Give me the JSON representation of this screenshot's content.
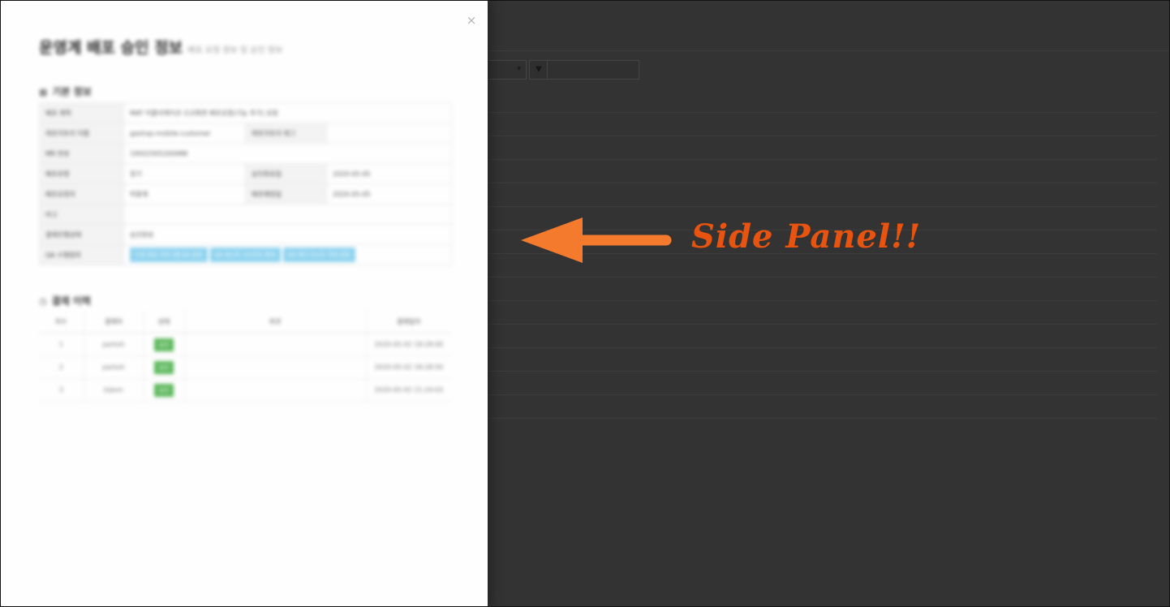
{
  "panel": {
    "close_symbol": "×",
    "title": "운영계 배포 승인 정보",
    "subtitle": "배포 요청 정보 및 승인 정보"
  },
  "basic_info": {
    "section_icon": "clipboard-icon",
    "title": "기본 정보",
    "rows": [
      [
        {
          "label": "배포 제목",
          "value": "MAT 어플리케이션 신규화면 배포요청(기능 추가) 요청",
          "span": 3
        }
      ],
      [
        {
          "label": "레포지토리 이름",
          "value": "gashop-mobile-customer"
        },
        {
          "label": "레포지토리 태그",
          "value": ""
        }
      ],
      [
        {
          "label": "MR 번호",
          "value": "19502505200988",
          "span": 3
        }
      ],
      [
        {
          "label": "배포유형",
          "value": "정기"
        },
        {
          "label": "승인완료일",
          "value": "2020-05-05"
        }
      ],
      [
        {
          "label": "배포요청자",
          "value": "박중재"
        },
        {
          "label": "배포예정일",
          "value": "2020-05-05"
        }
      ],
      [
        {
          "label": "비고",
          "value": "",
          "span": 3
        }
      ],
      [
        {
          "label": "결재진행상태",
          "value": "승인완료",
          "span": 3
        }
      ]
    ],
    "qa_label": "QA 수행범위",
    "qa_chips": [
      "수정 대상 프로그램 QA 완료",
      "QA 테스트 시나리오 통과",
      "QA 체크 리스트 작성 완료"
    ]
  },
  "history": {
    "section_icon": "history-icon",
    "title": "결재 이력",
    "headers": [
      "차수",
      "결재자",
      "상태",
      "의견",
      "결재일자"
    ],
    "rows": [
      {
        "seq": "1",
        "approver": "parkoh",
        "status": "승인",
        "opinion": "",
        "date": "2020-05-02 18:28:00"
      },
      {
        "seq": "2",
        "approver": "parkoh",
        "status": "승인",
        "opinion": "",
        "date": "2020-05-02 18:28:50"
      },
      {
        "seq": "3",
        "approver": "kijeon",
        "status": "승인",
        "opinion": "",
        "date": "2020-05-02 21:24:03"
      }
    ],
    "status_color": "#5cb85c"
  },
  "background": {
    "filter_icon": "funnel-icon",
    "filter_symbol": "▼",
    "select_caret": "▾"
  },
  "annotation": {
    "text": "Side Panel!!",
    "color": "#e8540f",
    "arrow_color": "#f47a2d"
  }
}
